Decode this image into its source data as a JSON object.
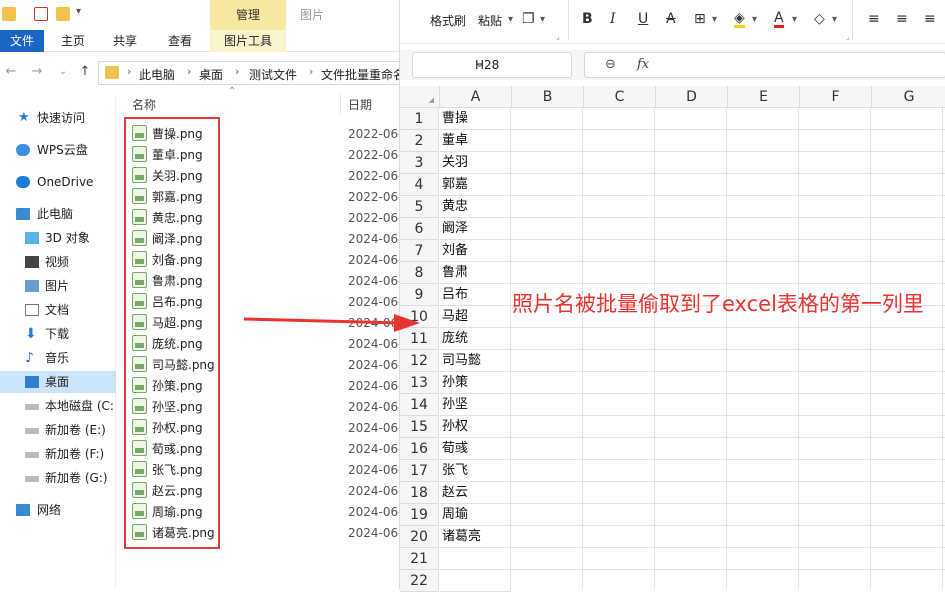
{
  "explorer": {
    "ribbon": {
      "context_tab": "管理",
      "picture_label": "图片",
      "tabs": [
        "文件",
        "主页",
        "共享",
        "查看",
        "图片工具"
      ]
    },
    "breadcrumbs": [
      "此电脑",
      "桌面",
      "测试文件",
      "文件批量重命名"
    ],
    "nav": [
      {
        "label": "快速访问",
        "icon": "star-icon"
      },
      {
        "label": "WPS云盘",
        "icon": "cloud-icon"
      },
      {
        "label": "OneDrive",
        "icon": "cloud-icon"
      },
      {
        "label": "此电脑",
        "icon": "computer-icon"
      },
      {
        "label": "3D 对象",
        "icon": "cube-icon"
      },
      {
        "label": "视频",
        "icon": "video-icon"
      },
      {
        "label": "图片",
        "icon": "picture-icon"
      },
      {
        "label": "文档",
        "icon": "document-icon"
      },
      {
        "label": "下载",
        "icon": "download-icon"
      },
      {
        "label": "音乐",
        "icon": "music-icon"
      },
      {
        "label": "桌面",
        "icon": "desktop-icon"
      },
      {
        "label": "本地磁盘 (C:",
        "icon": "drive-icon"
      },
      {
        "label": "新加卷 (E:)",
        "icon": "drive-icon"
      },
      {
        "label": "新加卷 (F:)",
        "icon": "drive-icon"
      },
      {
        "label": "新加卷 (G:)",
        "icon": "drive-icon"
      },
      {
        "label": "网络",
        "icon": "network-icon"
      }
    ],
    "columns": {
      "name": "名称",
      "date": "日期"
    },
    "files": [
      {
        "name": "曹操.png",
        "date": "2022-06-"
      },
      {
        "name": "董卓.png",
        "date": "2022-06-"
      },
      {
        "name": "关羽.png",
        "date": "2022-06-"
      },
      {
        "name": "郭嘉.png",
        "date": "2022-06-"
      },
      {
        "name": "黄忠.png",
        "date": "2022-06-"
      },
      {
        "name": "阚泽.png",
        "date": "2024-06-"
      },
      {
        "name": "刘备.png",
        "date": "2024-06-"
      },
      {
        "name": "鲁肃.png",
        "date": "2024-06-"
      },
      {
        "name": "吕布.png",
        "date": "2024-06-"
      },
      {
        "name": "马超.png",
        "date": "2024-06-"
      },
      {
        "name": "庞统.png",
        "date": "2024-06-"
      },
      {
        "name": "司马懿.png",
        "date": "2024-06-"
      },
      {
        "name": "孙策.png",
        "date": "2024-06-"
      },
      {
        "name": "孙坚.png",
        "date": "2024-06-"
      },
      {
        "name": "孙权.png",
        "date": "2024-06-"
      },
      {
        "name": "荀彧.png",
        "date": "2024-06-"
      },
      {
        "name": "张飞.png",
        "date": "2024-06-"
      },
      {
        "name": "赵云.png",
        "date": "2024-06-"
      },
      {
        "name": "周瑜.png",
        "date": "2024-06-"
      },
      {
        "name": "诸葛亮.png",
        "date": "2024-06-"
      }
    ]
  },
  "sheet": {
    "toolbar": {
      "format_painter": "格式刷",
      "paste": "粘贴"
    },
    "namebox": "H28",
    "fx": "fx",
    "col_headers": [
      "A",
      "B",
      "C",
      "D",
      "E",
      "F",
      "G"
    ],
    "row_numbers": [
      "1",
      "2",
      "3",
      "4",
      "5",
      "6",
      "7",
      "8",
      "9",
      "10",
      "11",
      "12",
      "13",
      "14",
      "15",
      "16",
      "17",
      "18",
      "19",
      "20",
      "21",
      "22"
    ],
    "column_a": [
      "曹操",
      "董卓",
      "关羽",
      "郭嘉",
      "黄忠",
      "阚泽",
      "刘备",
      "鲁肃",
      "吕布",
      "马超",
      "庞统",
      "司马懿",
      "孙策",
      "孙坚",
      "孙权",
      "荀彧",
      "张飞",
      "赵云",
      "周瑜",
      "诸葛亮",
      "",
      ""
    ]
  },
  "annotation": "照片名被批量偷取到了excel表格的第一列里",
  "colors": {
    "accent": "#1a66c4",
    "annotation": "#e8332f",
    "context_tab": "#f6e8a0"
  }
}
